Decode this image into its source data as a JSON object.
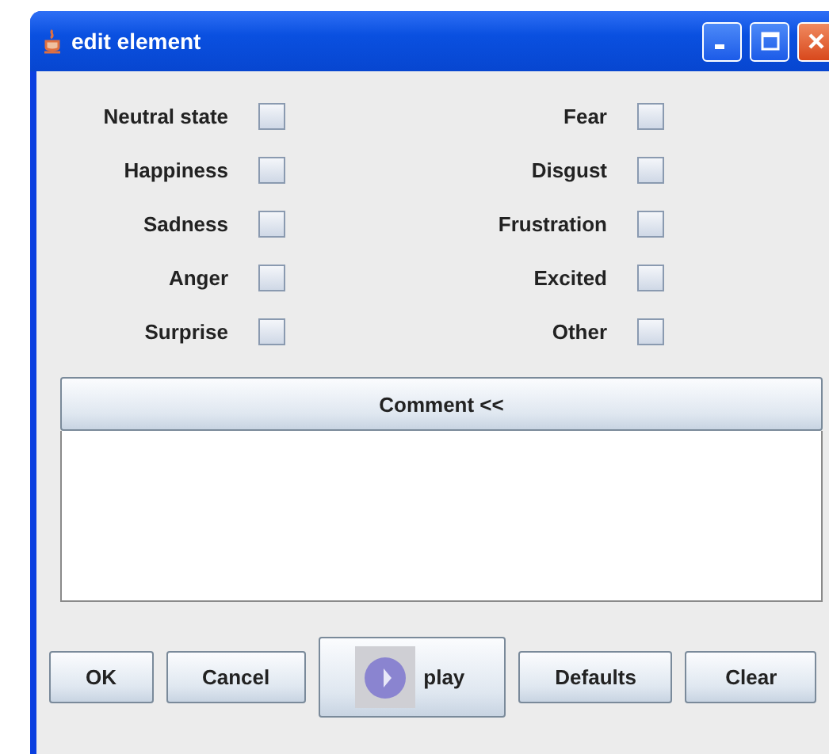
{
  "window": {
    "title": "edit element"
  },
  "emotions": [
    {
      "label": "Neutral state",
      "checked": false
    },
    {
      "label": "Fear",
      "checked": false
    },
    {
      "label": "Happiness",
      "checked": false
    },
    {
      "label": "Disgust",
      "checked": false
    },
    {
      "label": "Sadness",
      "checked": false
    },
    {
      "label": "Frustration",
      "checked": false
    },
    {
      "label": "Anger",
      "checked": false
    },
    {
      "label": "Excited",
      "checked": false
    },
    {
      "label": "Surprise",
      "checked": false
    },
    {
      "label": "Other",
      "checked": false
    }
  ],
  "comment": {
    "toggle": "Comment <<"
  },
  "buttons": [
    {
      "label": "OK",
      "kind": "plain"
    },
    {
      "label": "Cancel",
      "kind": "plain"
    },
    {
      "label": "play",
      "kind": "play"
    },
    {
      "label": "Defaults",
      "kind": "plain"
    },
    {
      "label": "Clear",
      "kind": "plain"
    }
  ]
}
